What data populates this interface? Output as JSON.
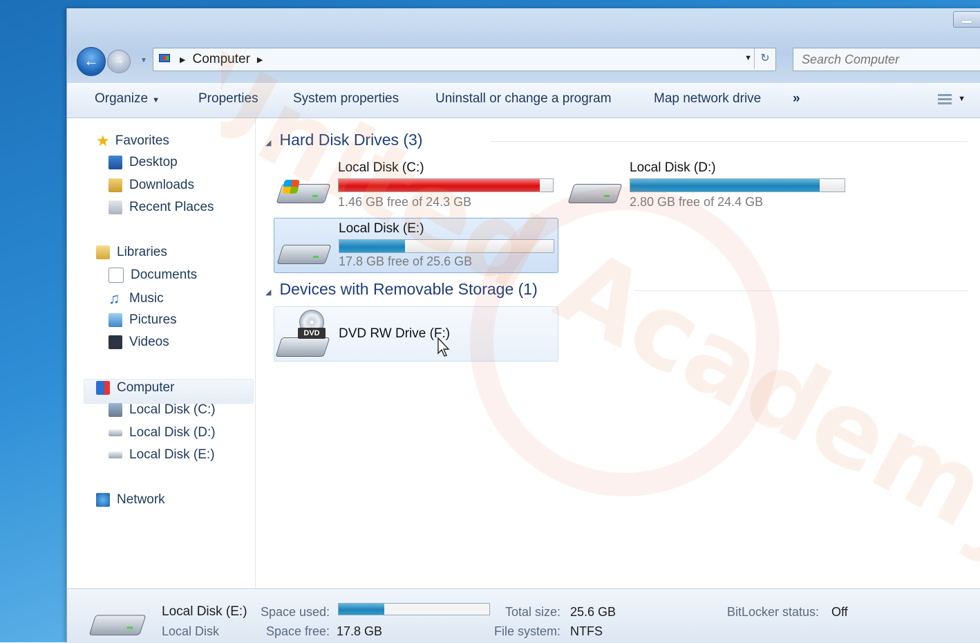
{
  "window": {
    "address": {
      "segments": [
        "Computer"
      ]
    },
    "search_placeholder": "Search Computer"
  },
  "toolbar": {
    "organize": "Organize",
    "properties": "Properties",
    "system_properties": "System properties",
    "uninstall": "Uninstall or change a program",
    "map_drive": "Map network drive",
    "more": "»"
  },
  "nav": {
    "favorites": "Favorites",
    "desktop": "Desktop",
    "downloads": "Downloads",
    "recent": "Recent Places",
    "libraries": "Libraries",
    "documents": "Documents",
    "music": "Music",
    "pictures": "Pictures",
    "videos": "Videos",
    "computer": "Computer",
    "disk_c": "Local Disk (C:)",
    "disk_d": "Local Disk (D:)",
    "disk_e": "Local Disk (E:)",
    "network": "Network"
  },
  "content": {
    "hdd_header": "Hard Disk Drives (3)",
    "removable_header": "Devices with Removable Storage (1)",
    "drives": [
      {
        "name": "Local Disk (C:)",
        "free": "1.46 GB free of 24.3 GB",
        "used_fraction": 0.94,
        "color": "#d80f0f"
      },
      {
        "name": "Local Disk (D:)",
        "free": "2.80 GB free of 24.4 GB",
        "used_fraction": 0.885,
        "color": "#1f82b8"
      },
      {
        "name": "Local Disk (E:)",
        "free": "17.8 GB free of 25.6 GB",
        "used_fraction": 0.305,
        "color": "#1f82b8"
      }
    ],
    "dvd": {
      "name": "DVD RW Drive (F:)",
      "badge": "DVD"
    }
  },
  "details": {
    "title": "Local Disk (E:)",
    "subtitle": "Local Disk",
    "space_used_label": "Space used:",
    "space_used_fraction": 0.305,
    "space_free_label": "Space free:",
    "space_free_value": "17.8 GB",
    "total_size_label": "Total size:",
    "total_size_value": "25.6 GB",
    "file_system_label": "File system:",
    "file_system_value": "NTFS",
    "bitlocker_label": "BitLocker status:",
    "bitlocker_value": "Off"
  },
  "watermark": {
    "text": "United Academy"
  }
}
